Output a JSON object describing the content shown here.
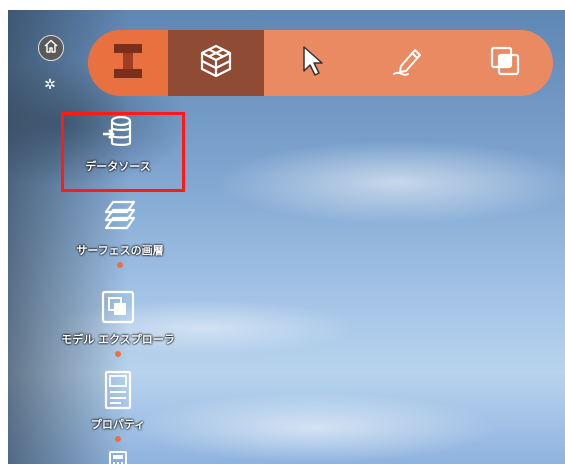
{
  "menu": {
    "items": [
      {
        "label": "データソース",
        "icon": "database-import-icon"
      },
      {
        "label": "サーフェスの画層",
        "icon": "layers-icon"
      },
      {
        "label": "モデル エクスプローラ",
        "icon": "model-explorer-icon"
      },
      {
        "label": "プロパティ",
        "icon": "properties-icon"
      },
      {
        "label": "",
        "icon": "calculator-icon"
      }
    ]
  },
  "toolbar": {
    "items": [
      "infraworks-logo-icon",
      "model-cube-icon",
      "select-pointer-icon",
      "sketch-pen-icon",
      "overlap-squares-icon"
    ]
  },
  "colors": {
    "accent": "#e9703f",
    "toolbar": "#ea8a63",
    "toolbar_active": "#8f4b33",
    "highlight": "#ff1a1a"
  }
}
